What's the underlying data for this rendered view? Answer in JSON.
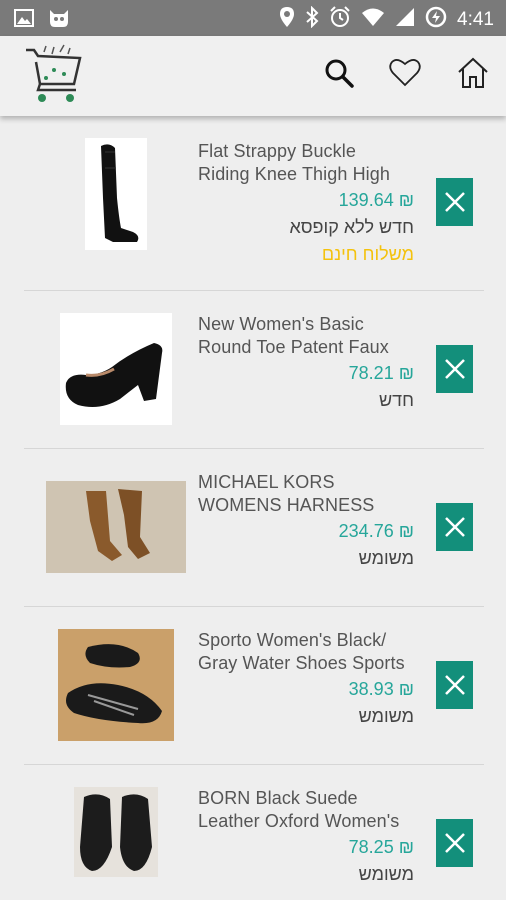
{
  "status_bar": {
    "time": "4:41"
  },
  "accent_color": "#138f7b",
  "price_color": "#26a69a",
  "shipping_color": "#f4c20d",
  "items": [
    {
      "title": "Flat Strappy Buckle\nRiding Knee Thigh High",
      "price": "139.64 ₪",
      "condition": "חדש ללא קופסא",
      "shipping": "משלוח חינם",
      "image": "black thigh-high riding boot"
    },
    {
      "title": "New Women's Basic\nRound Toe Patent Faux",
      "price": "78.21 ₪",
      "condition": "חדש",
      "image": "black patent wedge pump"
    },
    {
      "title": "MICHAEL KORS\nWOMENS HARNESS",
      "price": "234.76 ₪",
      "condition": "משומש",
      "image": "brown harness boots"
    },
    {
      "title": "Sporto Women's Black/\nGray Water Shoes Sports",
      "price": "38.93 ₪",
      "condition": "משומש",
      "image": "black gray water shoes"
    },
    {
      "title": "BORN Black Suede\nLeather Oxford Women's",
      "price": "78.25 ₪",
      "condition": "משומש",
      "image": "black suede oxford shoes"
    }
  ]
}
